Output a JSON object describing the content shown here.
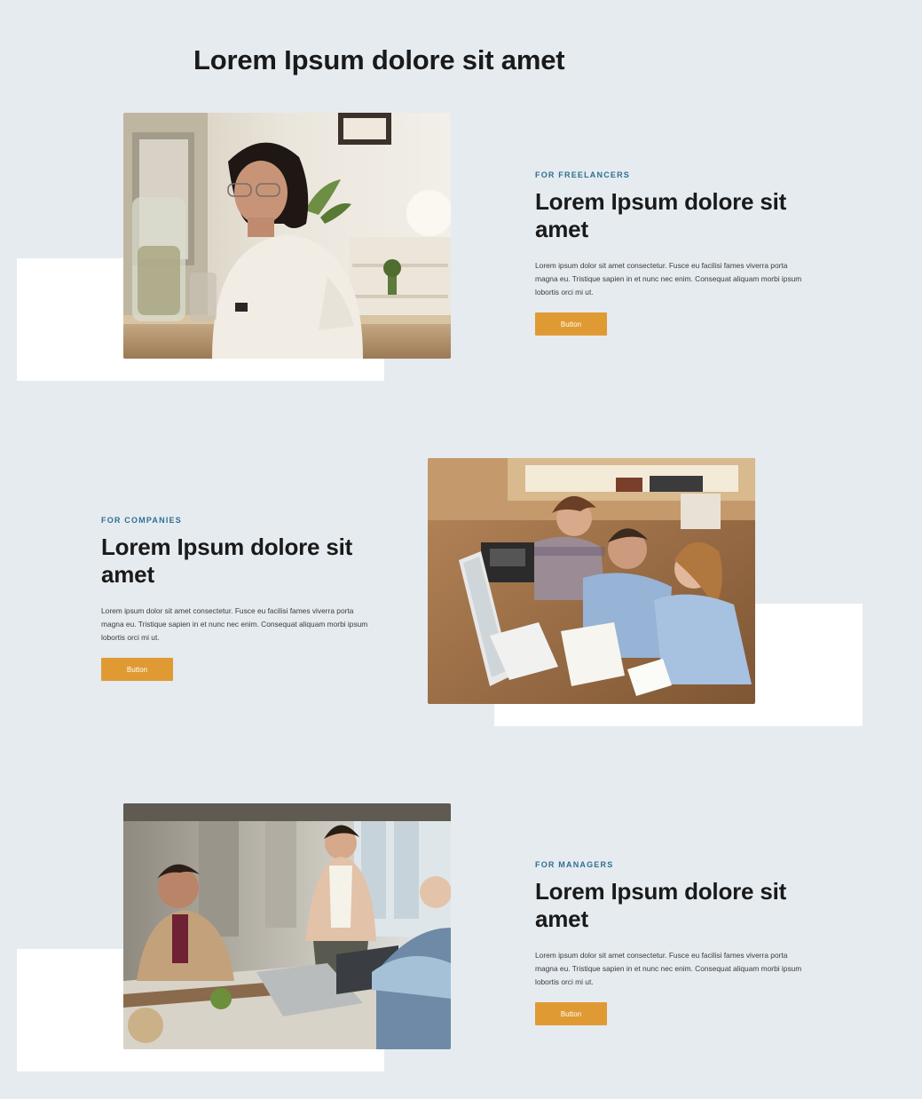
{
  "page": {
    "title": "Lorem Ipsum dolore sit amet"
  },
  "colors": {
    "background": "#e5ebef",
    "accent_button": "#e09a33",
    "eyebrow_text": "#2f6f91",
    "heading_text": "#1a1a1a"
  },
  "sections": [
    {
      "eyebrow": "FOR FREELANCERS",
      "heading": "Lorem Ipsum dolore sit amet",
      "body": "Lorem ipsum dolor sit amet consectetur. Fusce eu facilisi fames viverra porta magna eu. Tristique sapien in et nunc nec enim. Consequat aliquam morbi ipsum lobortis orci mi ut.",
      "button_label": "Button",
      "photo": "woman-working-at-laptop-photo"
    },
    {
      "eyebrow": "FOR COMPANIES",
      "heading": "Lorem Ipsum dolore sit amet",
      "body": "Lorem ipsum dolor sit amet consectetur. Fusce eu facilisi fames viverra porta magna eu. Tristique sapien in et nunc nec enim. Consequat aliquam morbi ipsum lobortis orci mi ut.",
      "button_label": "Button",
      "photo": "team-around-computer-photo"
    },
    {
      "eyebrow": "FOR MANAGERS",
      "heading": "Lorem Ipsum dolore sit amet",
      "body": "Lorem ipsum dolor sit amet consectetur. Fusce eu facilisi fames viverra porta magna eu. Tristique sapien in et nunc nec enim. Consequat aliquam morbi ipsum lobortis orci mi ut.",
      "button_label": "Button",
      "photo": "business-meeting-photo"
    }
  ]
}
